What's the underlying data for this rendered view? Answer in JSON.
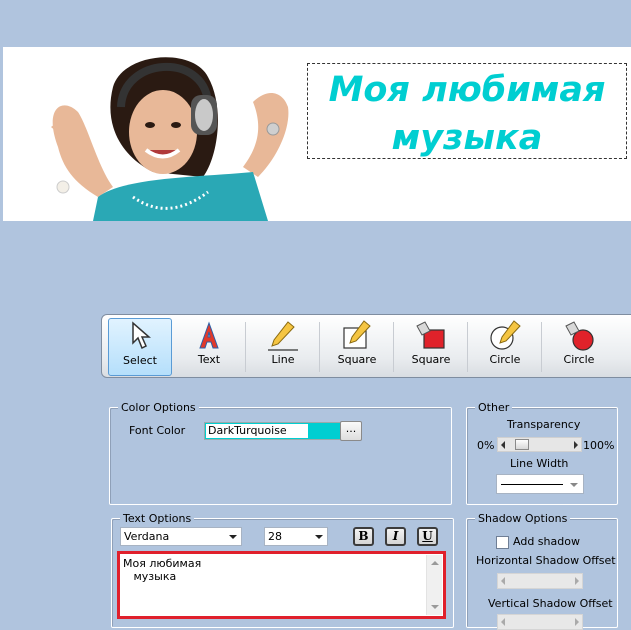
{
  "banner": {
    "photo_icon": "woman-with-headphones-photo",
    "line1": "Моя любимая",
    "line2": "музыка",
    "text_color": "#00ced1"
  },
  "toolbar": {
    "tools": [
      {
        "label": "Select",
        "icon": "cursor-arrow-icon",
        "selected": true
      },
      {
        "label": "Text",
        "icon": "text-a-icon"
      },
      {
        "label": "Line",
        "icon": "pencil-line-icon"
      },
      {
        "label": "Square",
        "icon": "pencil-square-icon"
      },
      {
        "label": "Square",
        "icon": "fill-square-icon"
      },
      {
        "label": "Circle",
        "icon": "pencil-circle-icon"
      },
      {
        "label": "Circle",
        "icon": "fill-circle-icon"
      }
    ]
  },
  "color_options": {
    "title": "Color Options",
    "font_color_label": "Font Color",
    "font_color_value": "DarkTurquoise",
    "swatch_color": "#00ced1",
    "browse_label": "..."
  },
  "other": {
    "title": "Other",
    "transparency_label": "Transparency",
    "min_label": "0%",
    "max_label": "100%",
    "transparency_value": 0.1,
    "line_width_label": "Line Width"
  },
  "text_options": {
    "title": "Text Options",
    "font_family": "Verdana",
    "font_size": "28",
    "bold_label": "B",
    "italic_label": "I",
    "underline_label": "U",
    "text_value": "Моя любимая\n   музыка"
  },
  "shadow_options": {
    "title": "Shadow Options",
    "add_shadow_label": "Add shadow",
    "add_shadow_checked": false,
    "horizontal_label": "Horizontal Shadow Offset",
    "vertical_label": "Vertical Shadow Offset"
  }
}
